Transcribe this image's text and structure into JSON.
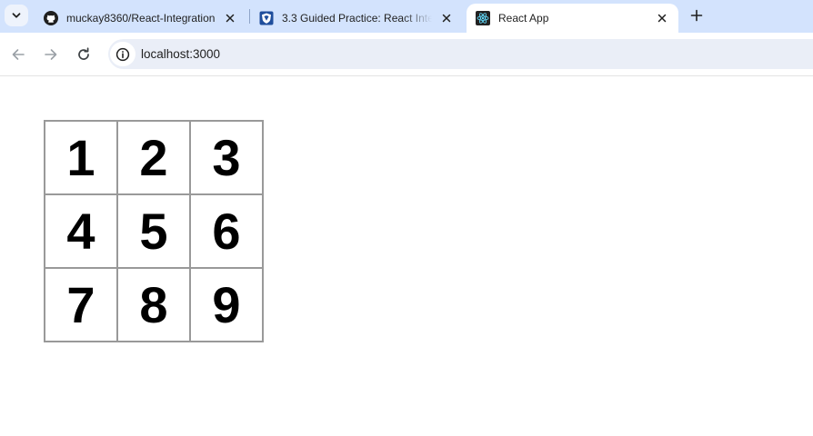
{
  "browser": {
    "tabs": [
      {
        "title": "muckay8360/React-Integration",
        "favicon": "github-icon",
        "active": false
      },
      {
        "title": "3.3 Guided Practice: React Integ",
        "favicon": "shield-icon",
        "active": false
      },
      {
        "title": "React App",
        "favicon": "react-icon",
        "active": true
      }
    ],
    "address": "localhost:3000"
  },
  "board": {
    "rows": [
      [
        "1",
        "2",
        "3"
      ],
      [
        "4",
        "5",
        "6"
      ],
      [
        "7",
        "8",
        "9"
      ]
    ]
  }
}
